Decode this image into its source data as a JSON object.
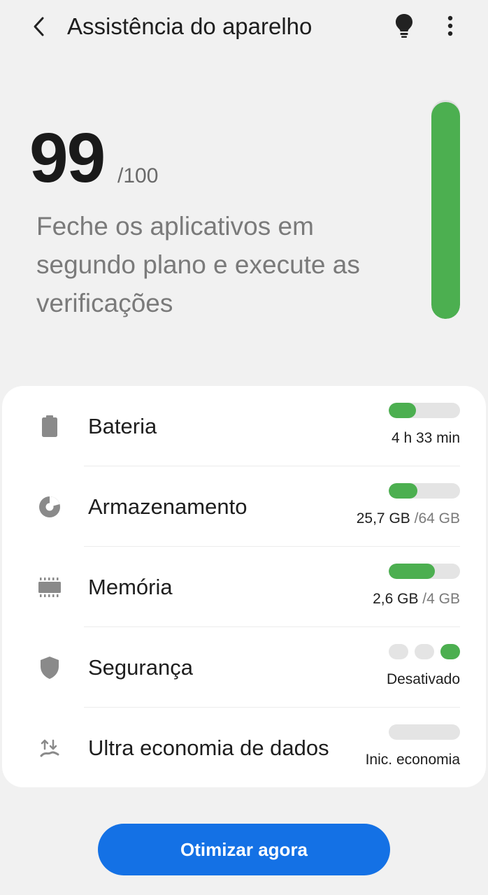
{
  "header": {
    "title": "Assistência do aparelho",
    "back_icon": "back-arrow-icon",
    "tips_icon": "lightbulb-icon",
    "more_icon": "more-vert-icon"
  },
  "score": {
    "value": "99",
    "max": "/100",
    "message": "Feche os aplicativos em segundo plano e execute as verificações",
    "level_fraction": 0.99,
    "bar_color": "#4caf50"
  },
  "items": [
    {
      "label": "Bateria",
      "value": "4 h 33 min",
      "value_max": "",
      "icon": "battery-icon",
      "level_fraction": 0.38
    },
    {
      "label": "Armazenamento",
      "value": "25,7 GB",
      "value_max": " /64 GB",
      "icon": "storage-icon",
      "level_fraction": 0.4
    },
    {
      "label": "Memória",
      "value": "2,6 GB",
      "value_max": " /4 GB",
      "icon": "memory-icon",
      "level_fraction": 0.65
    },
    {
      "label": "Segurança",
      "value": "Desativado",
      "value_max": "",
      "icon": "shield-icon",
      "active_dot": 2
    },
    {
      "label": "Ultra economia de dados",
      "value": "Inic. economia",
      "value_max": "",
      "icon": "data-saver-icon",
      "level_fraction": 0
    }
  ],
  "actions": {
    "optimize_label": "Otimizar agora"
  },
  "colors": {
    "accent": "#1471e5",
    "good": "#4caf50",
    "track": "#e4e4e4",
    "background": "#f1f1f1"
  }
}
